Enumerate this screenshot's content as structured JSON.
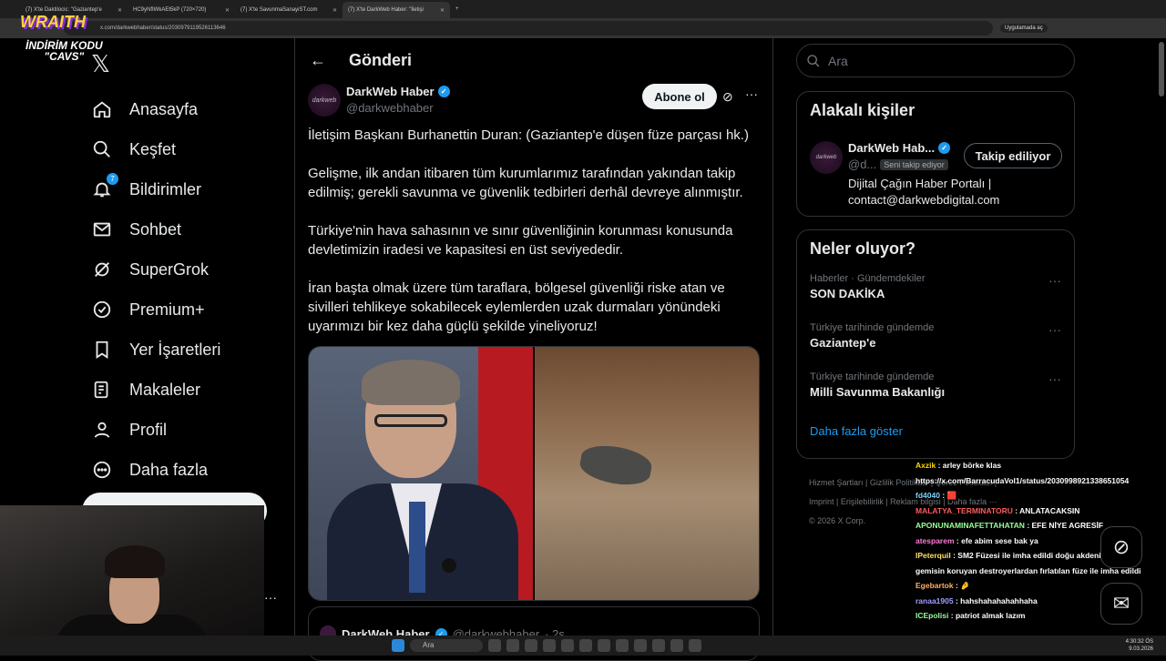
{
  "browser": {
    "tabs": [
      {
        "label": "(7) X'te Daktilocic: \"Gaziantep'e"
      },
      {
        "label": "HC9yNfIWkAEt5kP (720×720)"
      },
      {
        "label": "(7) X'te SavunmaSanayiST.com"
      },
      {
        "label": "(7) X'te DarkWeb Haber: \"İletişi"
      }
    ],
    "url": "x.com/darkwebhaber/status/2030979119526113646",
    "apps_label": "Uygulamada aç"
  },
  "overlay": {
    "brand": "WRAITH",
    "code_line1": "İNDİRİM KODU",
    "code_line2": "\"CAVS\""
  },
  "nav": {
    "items": [
      {
        "label": "Anasayfa",
        "icon": "home-icon"
      },
      {
        "label": "Keşfet",
        "icon": "search-icon"
      },
      {
        "label": "Bildirimler",
        "icon": "bell-icon",
        "badge": "7"
      },
      {
        "label": "Sohbet",
        "icon": "mail-icon"
      },
      {
        "label": "SuperGrok",
        "icon": "grok-icon"
      },
      {
        "label": "Premium+",
        "icon": "verified-icon"
      },
      {
        "label": "Yer İşaretleri",
        "icon": "bookmark-icon"
      },
      {
        "label": "Makaleler",
        "icon": "article-icon"
      },
      {
        "label": "Profil",
        "icon": "person-icon"
      },
      {
        "label": "Daha fazla",
        "icon": "more-circle-icon"
      }
    ]
  },
  "main": {
    "header_title": "Gönderi",
    "author_name": "DarkWeb Haber",
    "author_handle": "@darkwebhaber",
    "avatar_text": "darkweb",
    "subscribe_label": "Abone ol",
    "paragraphs": [
      "İletişim Başkanı Burhanettin Duran: (Gaziantep'e düşen füze parçası hk.)",
      "Gelişme, ilk andan itibaren tüm kurumlarımız tarafından yakından takip edilmiş; gerekli savunma ve güvenlik tedbirleri derhâl devreye alınmıştır.",
      "Türkiye'nin hava sahasının ve sınır güvenliğinin korunması konusunda devletimizin iradesi ve kapasitesi en üst seviyededir.",
      "İran başta olmak üzere tüm taraflara, bölgesel güvenliği riske atan ve sivilleri tehlikeye sokabilecek eylemlerden uzak durmaları yönündeki uyarımızı bir kez daha güçlü şekilde yineliyoruz!"
    ],
    "quote_name": "DarkWeb Haber",
    "quote_handle": "@darkwebhaber",
    "quote_time": "· 2s"
  },
  "sidebar": {
    "search_placeholder": "Ara",
    "related_title": "Alakalı kişiler",
    "related_name": "DarkWeb Hab...",
    "related_handle": "@d...",
    "related_follows_you": "Seni takip ediyor",
    "related_button": "Takip ediliyor",
    "related_bio_1": "Dijital Çağın Haber Portalı |",
    "related_bio_2": "contact@darkwebdigital.com",
    "trends_title": "Neler oluyor?",
    "trends": [
      {
        "category": "Haberler · Gündemdekiler",
        "name": "SON DAKİKA"
      },
      {
        "category": "Türkiye tarihinde gündemde",
        "name": "Gaziantep'e"
      },
      {
        "category": "Türkiye tarihinde gündemde",
        "name": "Milli Savunma Bakanlığı"
      }
    ],
    "show_more": "Daha fazla göster"
  },
  "footer": {
    "line1": "Hizmet Şartları  |  Gizlilik Politikası  |  Çerez Politikası  |",
    "line2": "Imprint  |  Erişilebilirlik  |  Reklam bilgisi  |  Daha fazla ···",
    "line3": "© 2026 X Corp."
  },
  "chat": [
    {
      "user": "Axzik",
      "msg": ": arley börke klas"
    },
    {
      "user": "",
      "msg": "https://x.com/BarracudaVol1/status/2030998921338651054"
    },
    {
      "user": "fd4040",
      "msg": ": 🟥"
    },
    {
      "user": "MALATYA_TERMINATORU",
      "msg": ": ANLATACAKSIN"
    },
    {
      "user": "APONUNAMINAFETTAHATAN",
      "msg": ": EFE NİYE AGRESİF"
    },
    {
      "user": "atesparem",
      "msg": ": efe abim sese bak ya"
    },
    {
      "user": "IPeterquil",
      "msg": ": SM2 Füzesi ile imha edildi doğu akdenizde uçak gemisin koruyan destroyerlardan fırlatılan füze ile imha edildi"
    },
    {
      "user": "Egebartok",
      "msg": ": 🤌"
    },
    {
      "user": "ranaa1905",
      "msg": ": hahshahahahahhaha"
    },
    {
      "user": "ICEpolisi",
      "msg": ": patriot almak lazım"
    }
  ],
  "taskbar": {
    "search": "Ara",
    "time": "4:30:32 ÖS",
    "date": "9.03.2026"
  }
}
